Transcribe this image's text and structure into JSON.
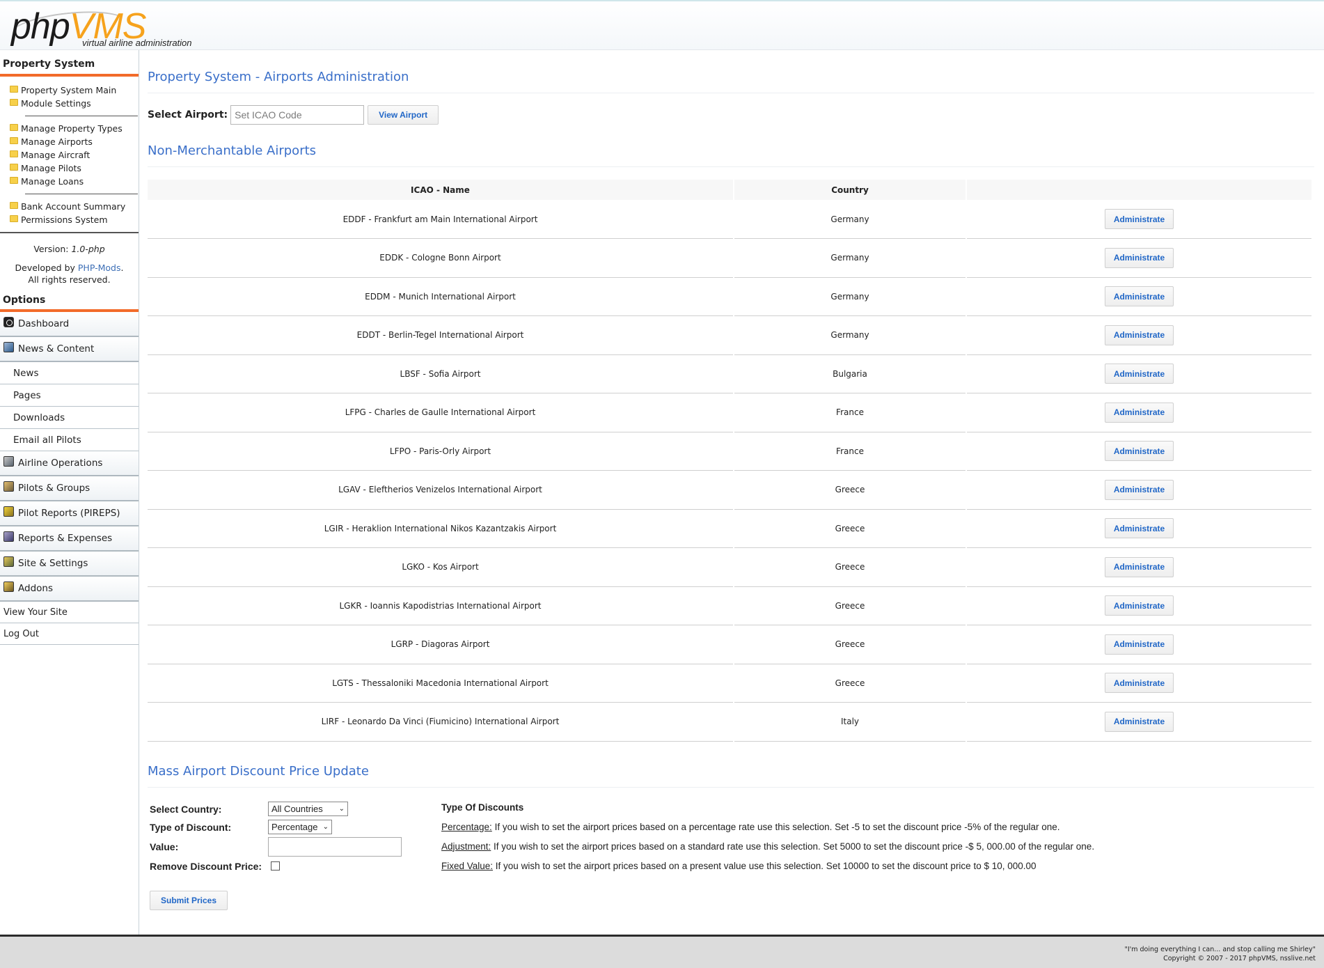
{
  "logo": {
    "php": "php",
    "vms": "VMS",
    "tagline": "virtual airline administration"
  },
  "sidebar": {
    "property_title": "Property System",
    "menu_groups": [
      [
        "Property System Main",
        "Module Settings"
      ],
      [
        "Manage Property Types",
        "Manage Airports",
        "Manage Aircraft",
        "Manage Pilots",
        "Manage Loans"
      ],
      [
        "Bank Account Summary",
        "Permissions System"
      ]
    ],
    "version_label": "Version: ",
    "version": "1.0-php",
    "developed_by": "Developed by ",
    "developer": "PHP-Mods",
    "rights": "All rights reserved.",
    "options_title": "Options",
    "options": [
      {
        "label": "Dashboard",
        "type": "section",
        "icon": "dashboard-icon"
      },
      {
        "label": "News & Content",
        "type": "section",
        "icon": "news-icon"
      },
      {
        "label": "News",
        "type": "plain"
      },
      {
        "label": "Pages",
        "type": "plain"
      },
      {
        "label": "Downloads",
        "type": "plain"
      },
      {
        "label": "Email all Pilots",
        "type": "plain"
      },
      {
        "label": "Airline Operations",
        "type": "section",
        "icon": "airline-operations-icon"
      },
      {
        "label": "Pilots & Groups",
        "type": "section",
        "icon": "pilots-groups-icon"
      },
      {
        "label": "Pilot Reports (PIREPS)",
        "type": "section",
        "icon": "pilot-reports-icon"
      },
      {
        "label": "Reports & Expenses",
        "type": "section",
        "icon": "reports-expenses-icon"
      },
      {
        "label": "Site & Settings",
        "type": "section",
        "icon": "site-settings-icon"
      },
      {
        "label": "Addons",
        "type": "section",
        "icon": "addons-icon"
      },
      {
        "label": "View Your Site",
        "type": "link"
      },
      {
        "label": "Log Out",
        "type": "link"
      }
    ]
  },
  "main": {
    "title": "Property System - Airports Administration",
    "select_label": "Select Airport:",
    "icao_placeholder": "Set ICAO Code",
    "view_button": "View Airport",
    "non_merch_title": "Non-Merchantable Airports",
    "table": {
      "headers": [
        "ICAO - Name",
        "Country",
        ""
      ],
      "action_label": "Administrate",
      "rows": [
        [
          "EDDF - Frankfurt am Main International Airport",
          "Germany"
        ],
        [
          "EDDK - Cologne Bonn Airport",
          "Germany"
        ],
        [
          "EDDM - Munich International Airport",
          "Germany"
        ],
        [
          "EDDT - Berlin-Tegel International Airport",
          "Germany"
        ],
        [
          "LBSF - Sofia Airport",
          "Bulgaria"
        ],
        [
          "LFPG - Charles de Gaulle International Airport",
          "France"
        ],
        [
          "LFPO - Paris-Orly Airport",
          "France"
        ],
        [
          "LGAV - Eleftherios Venizelos International Airport",
          "Greece"
        ],
        [
          "LGIR - Heraklion International Nikos Kazantzakis Airport",
          "Greece"
        ],
        [
          "LGKO - Kos Airport",
          "Greece"
        ],
        [
          "LGKR - Ioannis Kapodistrias International Airport",
          "Greece"
        ],
        [
          "LGRP - Diagoras Airport",
          "Greece"
        ],
        [
          "LGTS - Thessaloniki Macedonia International Airport",
          "Greece"
        ],
        [
          "LIRF - Leonardo Da Vinci (Fiumicino) International Airport",
          "Italy"
        ]
      ]
    },
    "mass": {
      "title": "Mass Airport Discount Price Update",
      "country_label": "Select Country:",
      "country_value": "All Countries",
      "discount_label": "Type of Discount:",
      "discount_value": "Percentage",
      "value_label": "Value:",
      "remove_label": "Remove Discount Price:",
      "submit": "Submit Prices",
      "types_title": "Type Of Discounts",
      "types": [
        {
          "name": "Percentage:",
          "text": " If you wish to set the airport prices based on a percentage rate use this selection. Set -5 to set the discount price -5% of the regular one."
        },
        {
          "name": "Adjustment:",
          "text": " If you wish to set the airport prices based on a standard rate use this selection. Set 5000 to set the discount price -$ 5, 000.00 of the regular one."
        },
        {
          "name": "Fixed Value:",
          "text": " If you wish to set the airport prices based on a present value use this selection. Set 10000 to set the discount price to $ 10, 000.00"
        }
      ]
    }
  },
  "footer": {
    "quote": "\"I'm doing everything I can... and stop calling me Shirley\"",
    "copyright": "Copyright © 2007 - 2017 phpVMS, nsslive.net"
  }
}
